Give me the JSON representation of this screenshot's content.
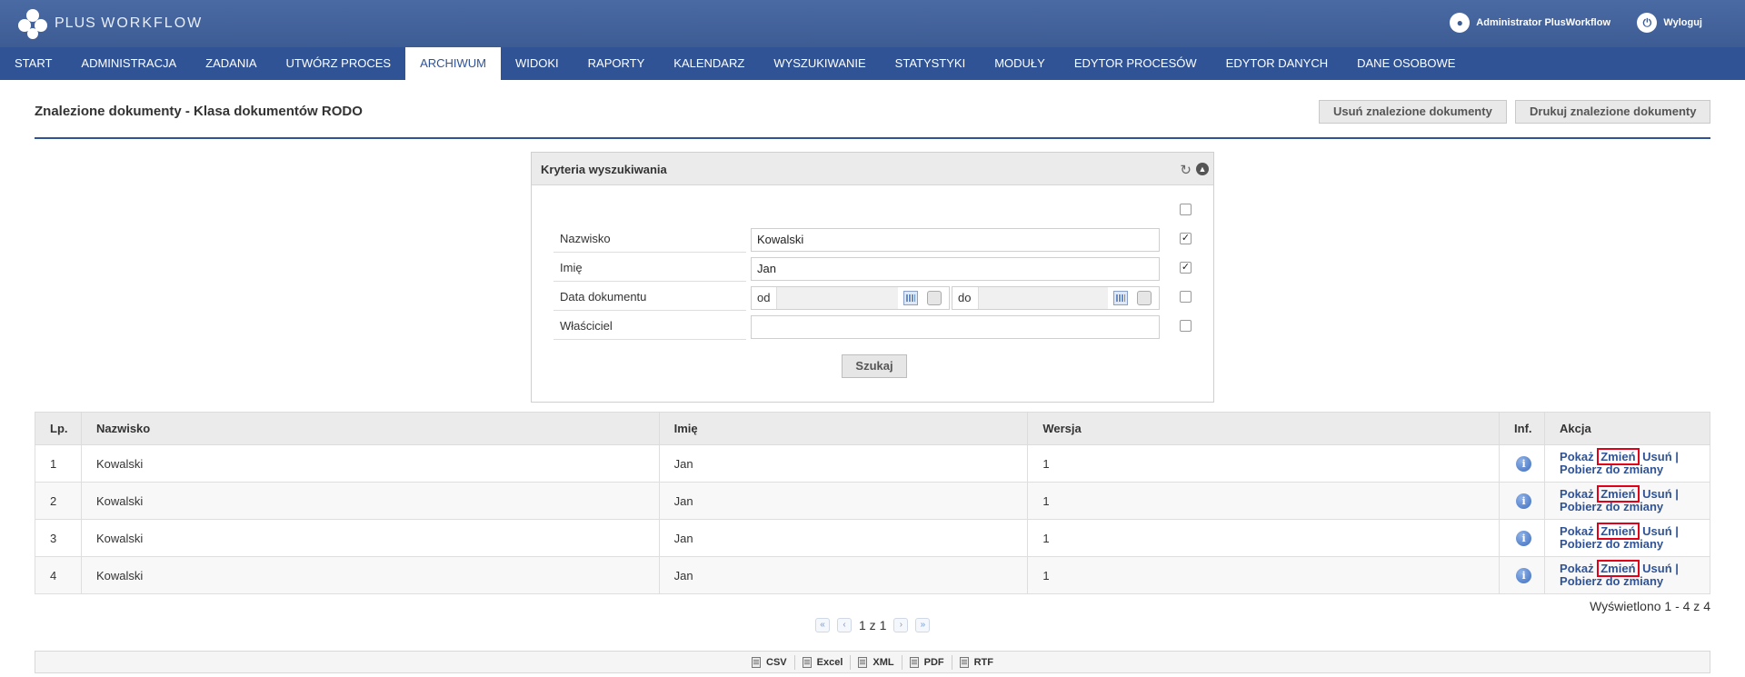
{
  "header": {
    "logo_plus": "PLUS",
    "logo_workflow": "WORKFLOW",
    "user_name": "Administrator PlusWorkflow",
    "logout_label": "Wyloguj"
  },
  "nav": {
    "items": [
      "START",
      "ADMINISTRACJA",
      "ZADANIA",
      "UTWÓRZ PROCES",
      "ARCHIWUM",
      "WIDOKI",
      "RAPORTY",
      "KALENDARZ",
      "WYSZUKIWANIE",
      "STATYSTYKI",
      "MODUŁY",
      "EDYTOR PROCESÓW",
      "EDYTOR DANYCH",
      "DANE OSOBOWE"
    ],
    "active": "ARCHIWUM"
  },
  "page": {
    "title": "Znalezione dokumenty - Klasa dokumentów RODO",
    "delete_found_label": "Usuń znalezione dokumenty",
    "print_found_label": "Drukuj znalezione dokumenty"
  },
  "criteria": {
    "title": "Kryteria wyszukiwania",
    "fields": {
      "surname_label": "Nazwisko",
      "surname_value": "Kowalski",
      "surname_checked": true,
      "firstname_label": "Imię",
      "firstname_value": "Jan",
      "firstname_checked": true,
      "date_label": "Data dokumentu",
      "date_from_label": "od",
      "date_to_label": "do",
      "date_checked": false,
      "owner_label": "Właściciel",
      "owner_value": "",
      "owner_checked": false
    },
    "select_all_checked": false,
    "search_label": "Szukaj"
  },
  "table": {
    "headers": {
      "lp": "Lp.",
      "surname": "Nazwisko",
      "firstname": "Imię",
      "version": "Wersja",
      "info": "Inf.",
      "action": "Akcja"
    },
    "rows": [
      {
        "lp": "1",
        "surname": "Kowalski",
        "firstname": "Jan",
        "version": "1"
      },
      {
        "lp": "2",
        "surname": "Kowalski",
        "firstname": "Jan",
        "version": "1"
      },
      {
        "lp": "3",
        "surname": "Kowalski",
        "firstname": "Jan",
        "version": "1"
      },
      {
        "lp": "4",
        "surname": "Kowalski",
        "firstname": "Jan",
        "version": "1"
      }
    ],
    "actions": {
      "show": "Pokaż",
      "change": "Zmień",
      "delete": "Usuń",
      "separator": "|",
      "fetch": "Pobierz do zmiany"
    }
  },
  "footer": {
    "shown_text": "Wyświetlono 1 - 4 z 4",
    "pager_text": "1 z 1",
    "export": [
      "CSV",
      "Excel",
      "XML",
      "PDF",
      "RTF"
    ]
  },
  "colors": {
    "header_blue": "#3d5c94",
    "nav_blue": "#2f5395",
    "highlight_red": "#e0001a"
  }
}
